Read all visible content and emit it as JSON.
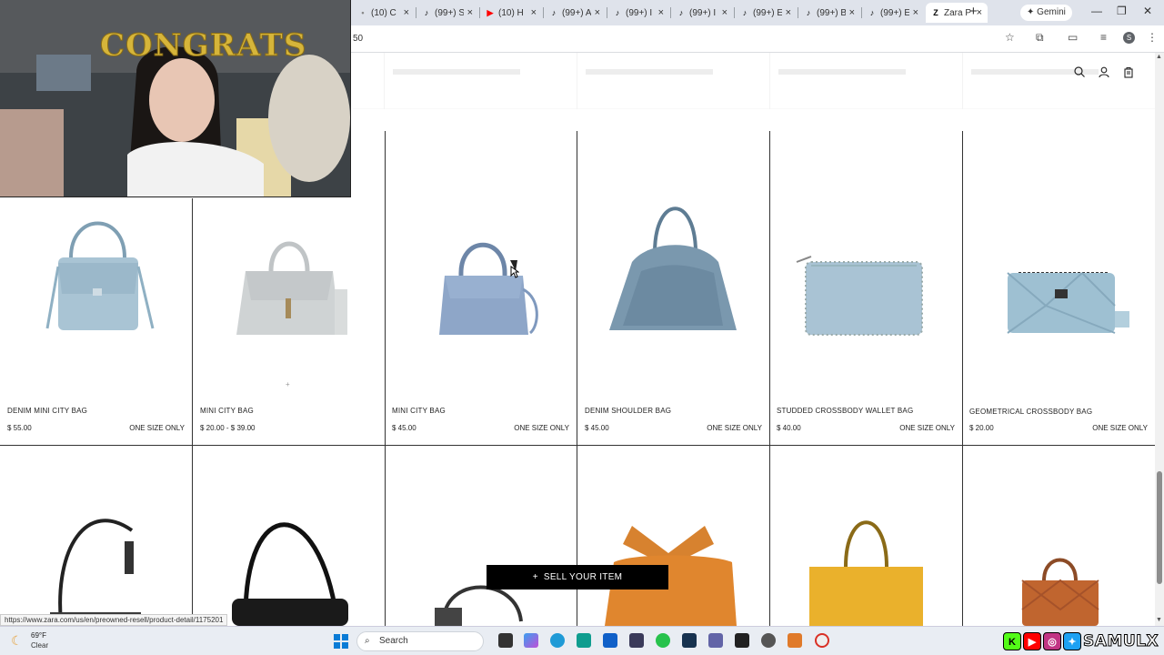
{
  "browser": {
    "tabs": [
      {
        "title": "(10) C",
        "favicon": "generic-icon"
      },
      {
        "title": "(99+) S",
        "favicon": "tiktok-icon"
      },
      {
        "title": "(10) H",
        "favicon": "youtube-icon"
      },
      {
        "title": "(99+) A",
        "favicon": "tiktok-icon"
      },
      {
        "title": "(99+) I",
        "favicon": "tiktok-icon"
      },
      {
        "title": "(99+) I",
        "favicon": "tiktok-icon"
      },
      {
        "title": "(99+) E",
        "favicon": "tiktok-icon"
      },
      {
        "title": "(99+) B",
        "favicon": "tiktok-icon"
      },
      {
        "title": "(99+) E",
        "favicon": "tiktok-icon"
      },
      {
        "title": "Zara P",
        "favicon": "zara-icon",
        "active": true
      }
    ],
    "gemini_label": "Gemini",
    "url_fragment": "50",
    "profile_initial": "S"
  },
  "products_row1": [
    {
      "name": "DENIM MINI CITY BAG",
      "price": "$ 55.00",
      "size": "ONE SIZE ONLY"
    },
    {
      "name": "MINI CITY BAG",
      "price": "$ 20.00 - $ 39.00",
      "size": ""
    },
    {
      "name": "MINI CITY BAG",
      "price": "$ 45.00",
      "size": "ONE SIZE ONLY"
    },
    {
      "name": "DENIM SHOULDER BAG",
      "price": "$ 45.00",
      "size": "ONE SIZE ONLY"
    },
    {
      "name": "STUDDED CROSSBODY WALLET BAG",
      "price": "$ 40.00",
      "size": "ONE SIZE ONLY"
    },
    {
      "name": "GEOMETRICAL CROSSBODY BAG",
      "price": "$ 20.00",
      "size": "ONE SIZE ONLY"
    }
  ],
  "sell_button": {
    "icon": "plus-icon",
    "label": "SELL YOUR ITEM"
  },
  "status_url": "https://www.zara.com/us/en/preowned-resell/product-detail/1175201",
  "webcam": {
    "banner": "CONGRATS"
  },
  "taskbar": {
    "weather_temp": "69°F",
    "weather_desc": "Clear",
    "search_placeholder": "Search",
    "social_handle": "SAMULX"
  },
  "colors": {
    "accent": "#000000",
    "denim": "#9fbfd3",
    "sell_button": "#000000"
  }
}
